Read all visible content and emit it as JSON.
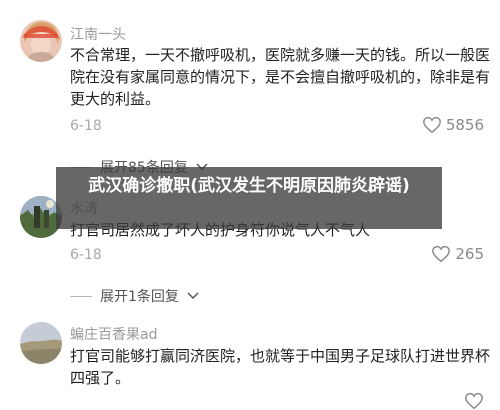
{
  "overlay": {
    "title": "武汉确诊撤职(武汉发生不明原因肺炎辟谣)"
  },
  "comments": [
    {
      "username": "江南一头",
      "text": "不合常理，一天不撤呼吸机，医院就多赚一天的钱。所以一般医院在没有家属同意的情况下，是不会擅自撤呼吸机的，除非是有更大的利益。",
      "date": "6-18",
      "likes": "5856",
      "expand": "展开85条回复"
    },
    {
      "username": "水涛",
      "text": "打官司居然成了坏人的护身符你说气人不气人",
      "date": "6-18",
      "likes": "265",
      "expand": "展开1条回复"
    },
    {
      "username": "蝙庄百香果ad",
      "text": "打官司能够打赢同济医院，也就等于中国男子足球队打进世界杯四强了。",
      "date": "",
      "likes": ""
    }
  ],
  "colors": {
    "overlay": "#3c3c3c",
    "text": "#222222",
    "muted": "#9a9a9a"
  }
}
